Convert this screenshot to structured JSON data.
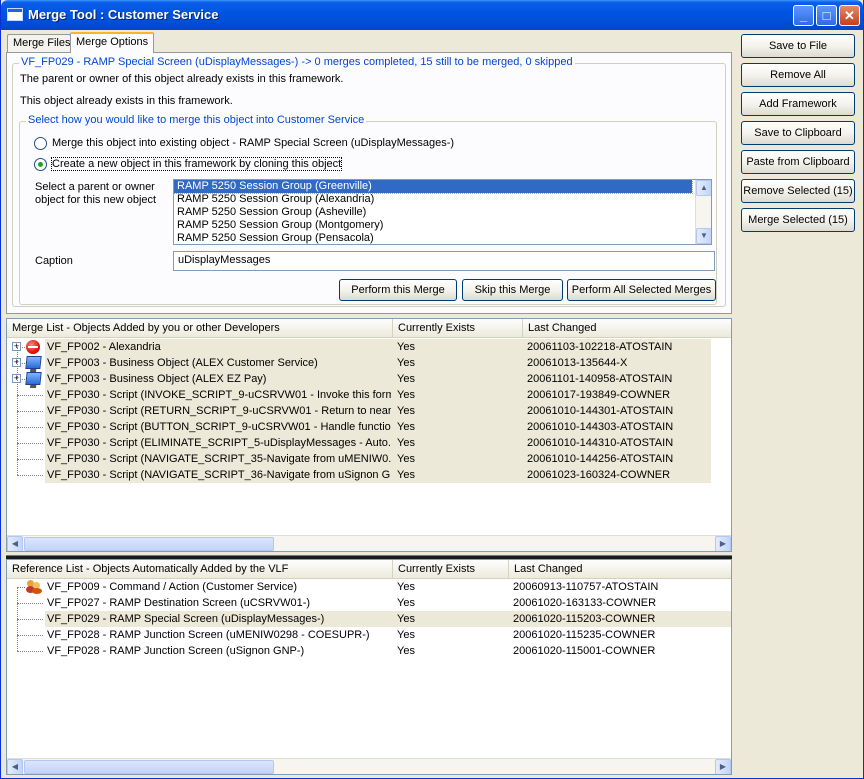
{
  "window": {
    "title": "Merge Tool : Customer Service",
    "min_label": "_",
    "max_label": "□",
    "close_label": "✕"
  },
  "tabs": [
    {
      "label": "Merge Files"
    },
    {
      "label": "Merge Options"
    }
  ],
  "options": {
    "group_title": "VF_FP029 - RAMP Special Screen (uDisplayMessages-) -> 0 merges completed, 15 still to be merged, 0 skipped",
    "info_line1": "The parent or owner of this object already exists in this framework.",
    "info_line2": "This object already exists in this framework.",
    "choice_title": "Select how you would like to merge this object into Customer Service",
    "radio_merge": "Merge this object into existing object - RAMP Special Screen (uDisplayMessages-)",
    "radio_clone": "Create a new object in this framework by cloning this object",
    "parent_label_line1": "Select a parent or owner",
    "parent_label_line2": "object for this new object",
    "parent_items": [
      "RAMP 5250 Session Group (Greenville)",
      "RAMP 5250 Session Group (Alexandria)",
      "RAMP 5250 Session Group (Asheville)",
      "RAMP 5250 Session Group (Montgomery)",
      "RAMP 5250 Session Group (Pensacola)"
    ],
    "caption_label": "Caption",
    "caption_value": "uDisplayMessages",
    "perform_merge": "Perform this Merge",
    "skip_merge": "Skip this Merge",
    "perform_all": "Perform All Selected Merges"
  },
  "right_buttons": [
    "Save to File",
    "Remove All",
    "Add Framework",
    "Save to Clipboard",
    "Paste from Clipboard",
    "Remove Selected (15)",
    "Merge Selected (15)"
  ],
  "merge_list": {
    "headers": [
      "Merge List - Objects Added by you or other Developers",
      "Currently Exists",
      "Last Changed"
    ],
    "rows": [
      {
        "name": "VF_FP002 - Alexandria",
        "exists": "Yes",
        "changed": "20061103-102218-ATOSTAIN",
        "icon": "red-circle-icon"
      },
      {
        "name": "VF_FP003 - Business Object (ALEX Customer Service)",
        "exists": "Yes",
        "changed": "20061013-135644-X",
        "icon": "monitor-icon"
      },
      {
        "name": "VF_FP003 - Business Object (ALEX EZ Pay)",
        "exists": "Yes",
        "changed": "20061101-140958-ATOSTAIN",
        "icon": "monitor-icon"
      },
      {
        "name": "VF_FP030 - Script (INVOKE_SCRIPT_9-uCSRVW01 - Invoke this form...",
        "exists": "Yes",
        "changed": "20061017-193849-COWNER",
        "icon": ""
      },
      {
        "name": "VF_FP030 - Script (RETURN_SCRIPT_9-uCSRVW01 - Return to near...",
        "exists": "Yes",
        "changed": "20061010-144301-ATOSTAIN",
        "icon": ""
      },
      {
        "name": "VF_FP030 - Script (BUTTON_SCRIPT_9-uCSRVW01 - Handle functio...",
        "exists": "Yes",
        "changed": "20061010-144303-ATOSTAIN",
        "icon": ""
      },
      {
        "name": "VF_FP030 - Script (ELIMINATE_SCRIPT_5-uDisplayMessages - Auto...",
        "exists": "Yes",
        "changed": "20061010-144310-ATOSTAIN",
        "icon": ""
      },
      {
        "name": "VF_FP030 - Script (NAVIGATE_SCRIPT_35-Navigate from uMENIW0...",
        "exists": "Yes",
        "changed": "20061010-144256-ATOSTAIN",
        "icon": ""
      },
      {
        "name": "VF_FP030 - Script (NAVIGATE_SCRIPT_36-Navigate from uSignon G...",
        "exists": "Yes",
        "changed": "20061023-160324-COWNER",
        "icon": ""
      }
    ]
  },
  "reference_list": {
    "headers": [
      "Reference List -  Objects Automatically Added by the VLF",
      "Currently Exists",
      "Last Changed"
    ],
    "rows": [
      {
        "name": "VF_FP009 - Command / Action (Customer Service)",
        "exists": "Yes",
        "changed": "20060913-110757-ATOSTAIN",
        "icon": "people-icon"
      },
      {
        "name": "VF_FP027 - RAMP Destination Screen (uCSRVW01-)",
        "exists": "Yes",
        "changed": "20061020-163133-COWNER",
        "icon": ""
      },
      {
        "name": "VF_FP029 - RAMP Special Screen (uDisplayMessages-)",
        "exists": "Yes",
        "changed": "20061020-115203-COWNER",
        "icon": ""
      },
      {
        "name": "VF_FP028 - RAMP Junction Screen (uMENIW0298 - COESUPR-)",
        "exists": "Yes",
        "changed": "20061020-115235-COWNER",
        "icon": ""
      },
      {
        "name": "VF_FP028 - RAMP Junction Screen (uSignon GNP-)",
        "exists": "Yes",
        "changed": "20061020-115001-COWNER",
        "icon": ""
      }
    ]
  },
  "colors": {
    "titlebar": "#0054e3",
    "group_title": "#0046d5",
    "selection": "#316ac5",
    "row_highlight": "#ece9d8"
  }
}
